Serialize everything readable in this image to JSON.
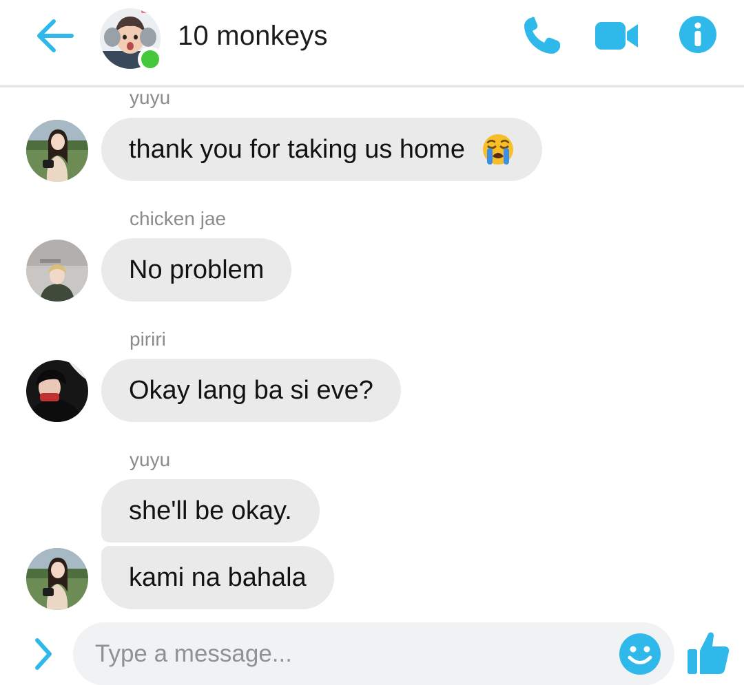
{
  "header": {
    "title": "10 monkeys",
    "online": true,
    "accent_color": "#2fb8ea",
    "online_color": "#45c93b",
    "icons": [
      "back-arrow-icon",
      "phone-icon",
      "video-camera-icon",
      "info-icon"
    ]
  },
  "messages": [
    {
      "sender": "yuyu",
      "text": "thank you for taking us home",
      "emoji": "loudly-crying-face"
    },
    {
      "sender": "chicken jae",
      "text": "No problem"
    },
    {
      "sender": "piriri",
      "text": "Okay lang ba si eve?"
    },
    {
      "sender": "yuyu",
      "text": "she'll be okay."
    },
    {
      "sender": "yuyu",
      "text": "kami na bahala"
    }
  ],
  "composer": {
    "placeholder": "Type a message...",
    "value": "",
    "icons": [
      "chevron-right-icon",
      "smiley-icon",
      "thumbs-up-icon"
    ]
  }
}
